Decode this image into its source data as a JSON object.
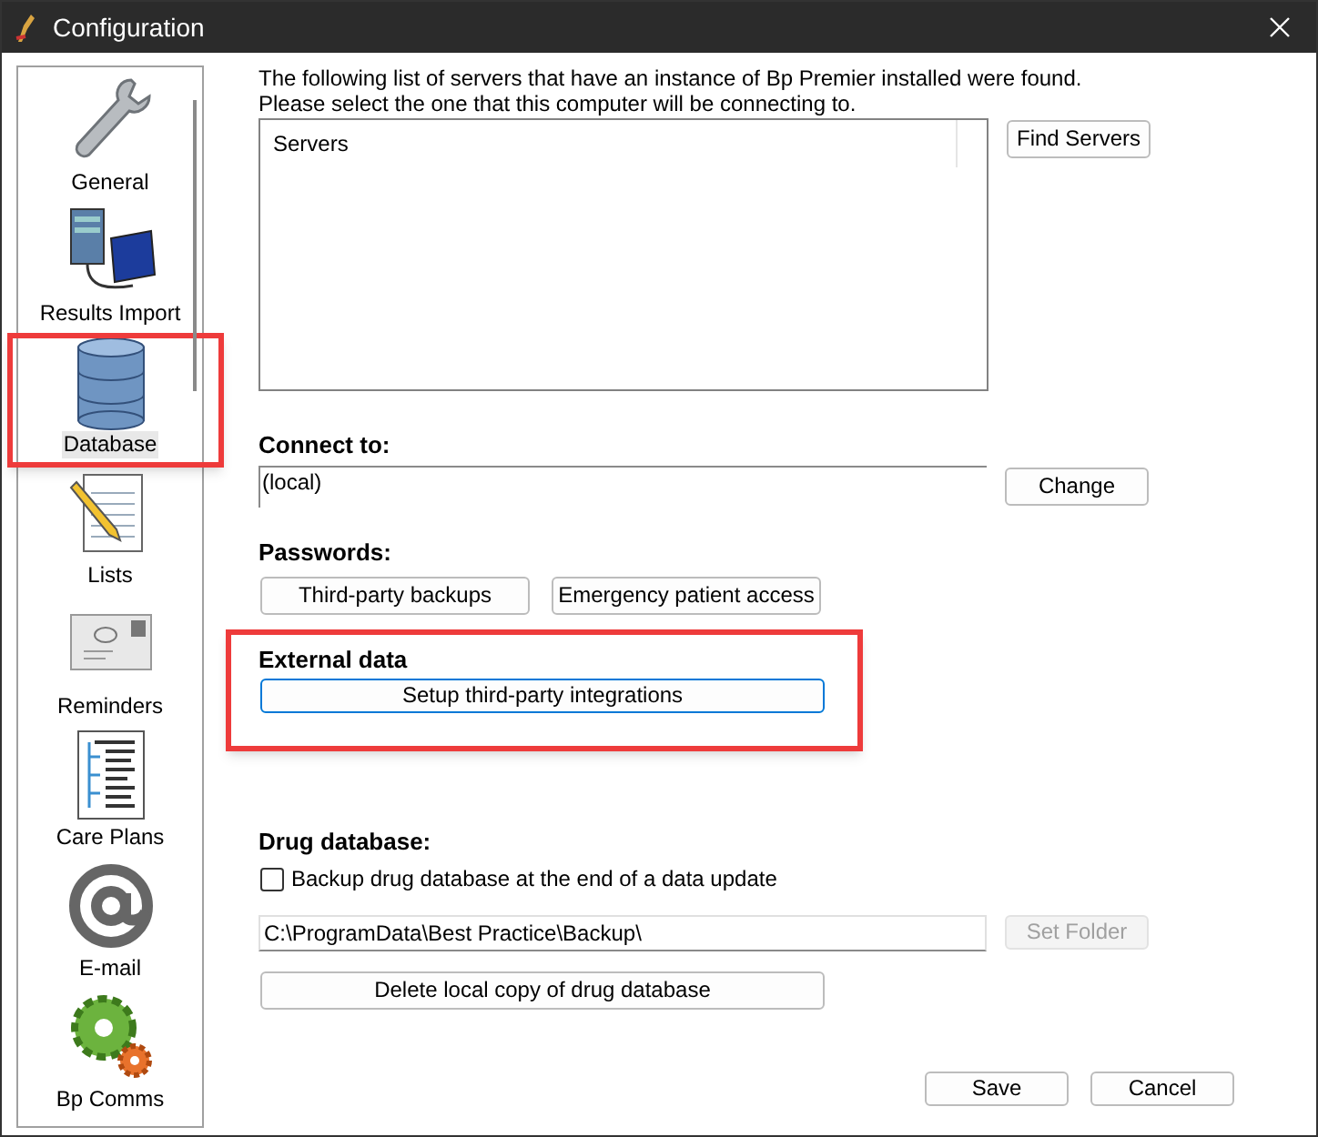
{
  "window": {
    "title": "Configuration"
  },
  "sidebar": {
    "items": [
      {
        "label": "General",
        "selected": false,
        "highlighted": false
      },
      {
        "label": "Results Import",
        "selected": false,
        "highlighted": false
      },
      {
        "label": "Database",
        "selected": true,
        "highlighted": true
      },
      {
        "label": "Lists",
        "selected": false,
        "highlighted": false
      },
      {
        "label": "Reminders",
        "selected": false,
        "highlighted": false
      },
      {
        "label": "Care Plans",
        "selected": false,
        "highlighted": false
      },
      {
        "label": "E-mail",
        "selected": false,
        "highlighted": false
      },
      {
        "label": "Bp Comms",
        "selected": false,
        "highlighted": false
      }
    ]
  },
  "servers": {
    "intro": [
      "The following list of servers that have an instance of Bp Premier installed were found.",
      "Please select the one that this computer will be connecting to."
    ],
    "column": "Servers",
    "find_button": "Find Servers"
  },
  "connect": {
    "heading": "Connect to:",
    "value": "(local)",
    "change_button": "Change"
  },
  "passwords": {
    "heading": "Passwords:",
    "buttons": [
      "Third-party backups",
      "Emergency patient access"
    ]
  },
  "external": {
    "heading": "External data",
    "button": "Setup third-party integrations",
    "highlighted": true
  },
  "drug": {
    "heading": "Drug database:",
    "checkbox": {
      "label": "Backup drug database at the end of a data update",
      "checked": false
    },
    "folder": "C:\\ProgramData\\Best Practice\\Backup\\",
    "set_folder": {
      "label": "Set Folder",
      "disabled": true
    },
    "delete_button": "Delete local copy of drug database"
  },
  "footer": {
    "buttons": [
      "Save",
      "Cancel"
    ]
  }
}
